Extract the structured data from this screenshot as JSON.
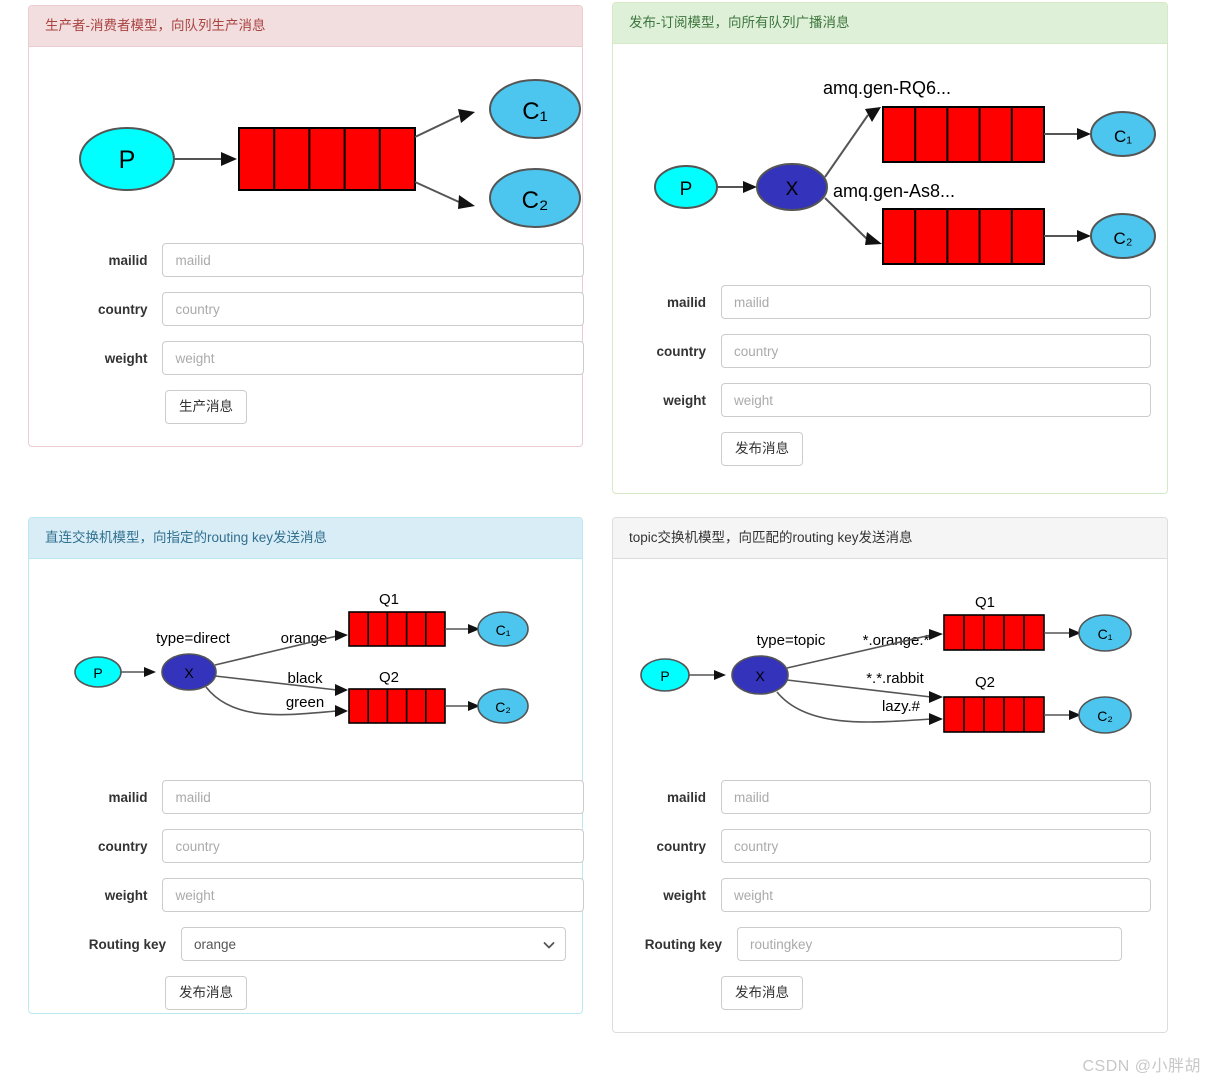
{
  "watermark": "CSDN @小胖胡",
  "common": {
    "labels": {
      "mailid": "mailid",
      "country": "country",
      "weight": "weight",
      "routing_key": "Routing key"
    },
    "placeholders": {
      "mailid": "mailid",
      "country": "country",
      "weight": "weight",
      "routingkey": "routingkey"
    }
  },
  "cards": [
    {
      "id": "producer-consumer",
      "title": "生产者-消费者模型，向队列生产消息",
      "style": "danger",
      "button_label": "生产消息",
      "diagram": {
        "type": "producer-queue-consumers",
        "nodes": [
          {
            "name": "P",
            "kind": "producer"
          },
          {
            "name": "C₁",
            "kind": "consumer"
          },
          {
            "name": "C₂",
            "kind": "consumer"
          }
        ],
        "queues": [
          {
            "label": "",
            "cells": 5
          }
        ]
      },
      "fields": [
        {
          "label": "mailid",
          "placeholder": "mailid",
          "value": "",
          "control": "input"
        },
        {
          "label": "country",
          "placeholder": "country",
          "value": "",
          "control": "input"
        },
        {
          "label": "weight",
          "placeholder": "weight",
          "value": "",
          "control": "input"
        }
      ]
    },
    {
      "id": "publish-subscribe",
      "title": "发布-订阅模型，向所有队列广播消息",
      "style": "success",
      "button_label": "发布消息",
      "diagram": {
        "type": "fanout-exchange",
        "exchange_label": "X",
        "nodes": [
          {
            "name": "P",
            "kind": "producer"
          },
          {
            "name": "C₁",
            "kind": "consumer"
          },
          {
            "name": "C₂",
            "kind": "consumer"
          }
        ],
        "queues": [
          {
            "label": "amq.gen-RQ6...",
            "cells": 5
          },
          {
            "label": "amq.gen-As8...",
            "cells": 5
          }
        ]
      },
      "fields": [
        {
          "label": "mailid",
          "placeholder": "mailid",
          "value": "",
          "control": "input"
        },
        {
          "label": "country",
          "placeholder": "country",
          "value": "",
          "control": "input"
        },
        {
          "label": "weight",
          "placeholder": "weight",
          "value": "",
          "control": "input"
        }
      ]
    },
    {
      "id": "direct-exchange",
      "title": "直连交换机模型，向指定的routing key发送消息",
      "style": "info",
      "button_label": "发布消息",
      "diagram": {
        "type": "direct-exchange",
        "exchange_label": "X",
        "exchange_type_label": "type=direct",
        "binding_keys": [
          "orange",
          "black",
          "green"
        ],
        "nodes": [
          {
            "name": "P",
            "kind": "producer"
          },
          {
            "name": "C₁",
            "kind": "consumer"
          },
          {
            "name": "C₂",
            "kind": "consumer"
          }
        ],
        "queues": [
          {
            "label": "Q1",
            "cells": 5
          },
          {
            "label": "Q2",
            "cells": 5
          }
        ]
      },
      "fields": [
        {
          "label": "mailid",
          "placeholder": "mailid",
          "value": "",
          "control": "input"
        },
        {
          "label": "country",
          "placeholder": "country",
          "value": "",
          "control": "input"
        },
        {
          "label": "weight",
          "placeholder": "weight",
          "value": "",
          "control": "input"
        },
        {
          "label": "Routing key",
          "placeholder": "",
          "value": "orange",
          "control": "select",
          "options": [
            "orange",
            "black",
            "green"
          ]
        }
      ]
    },
    {
      "id": "topic-exchange",
      "title": "topic交换机模型，向匹配的routing key发送消息",
      "style": "default",
      "button_label": "发布消息",
      "diagram": {
        "type": "topic-exchange",
        "exchange_label": "X",
        "exchange_type_label": "type=topic",
        "binding_keys": [
          "*.orange.*",
          "*.*.rabbit",
          "lazy.#"
        ],
        "nodes": [
          {
            "name": "P",
            "kind": "producer"
          },
          {
            "name": "C₁",
            "kind": "consumer"
          },
          {
            "name": "C₂",
            "kind": "consumer"
          }
        ],
        "queues": [
          {
            "label": "Q1",
            "cells": 5
          },
          {
            "label": "Q2",
            "cells": 5
          }
        ]
      },
      "fields": [
        {
          "label": "mailid",
          "placeholder": "mailid",
          "value": "",
          "control": "input"
        },
        {
          "label": "country",
          "placeholder": "country",
          "value": "",
          "control": "input"
        },
        {
          "label": "weight",
          "placeholder": "weight",
          "value": "",
          "control": "input"
        },
        {
          "label": "Routing key",
          "placeholder": "routingkey",
          "value": "",
          "control": "input"
        }
      ]
    }
  ],
  "colors": {
    "producer_fill": "#00ffff",
    "consumer_fill": "#4cc6ee",
    "exchange_fill": "#3333bb",
    "queue_fill": "#ff0000",
    "stroke": "#555555"
  }
}
